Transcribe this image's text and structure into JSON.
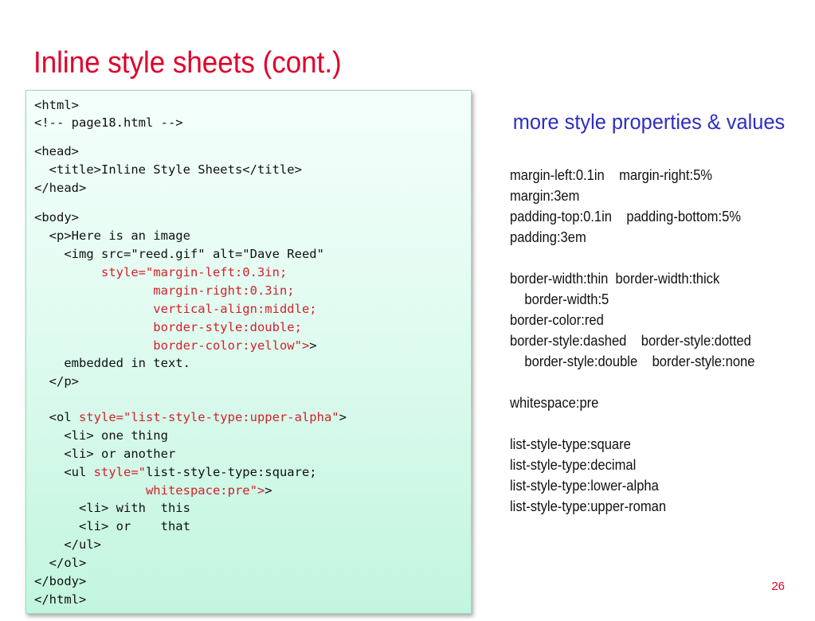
{
  "slide": {
    "title": "Inline style sheets (cont.)",
    "page_number": "26"
  },
  "code": {
    "lines": [
      "<html>",
      "<!-- page18.html -->",
      "<head>",
      "  <title>Inline Style Sheets</title>",
      "</head>",
      "<body>",
      "  <p>Here is an image",
      "    <img src=\"reed.gif\" alt=\"Dave Reed\"",
      "         style=\"margin-left:0.3in;",
      "                margin-right:0.3in;",
      "                vertical-align:middle;",
      "                border-style:double;",
      "                border-color:yellow\">",
      "    embedded in text.",
      "  </p>",
      "  <ol style=\"list-style-type:upper-alpha\">",
      "    <li> one thing",
      "    <li> or another",
      "    <ul style=\"list-style-type:square;",
      "               whitespace:pre\">",
      "      <li> with  this",
      "      <li> or    that",
      "    </ul>",
      "  </ol>",
      "</body>",
      "</html>"
    ],
    "line14_close": ">",
    "line19_open": "    <ul ",
    "line20_close": ">"
  },
  "properties": {
    "heading": "more style properties & values",
    "lines": [
      "margin-left:0.1in    margin-right:5%",
      "margin:3em",
      "padding-top:0.1in    padding-bottom:5%",
      "padding:3em",
      "border-width:thin  border-width:thick",
      "    border-width:5",
      "border-color:red",
      "border-style:dashed    border-style:dotted",
      "    border-style:double    border-style:none",
      "whitespace:pre",
      "list-style-type:square",
      "list-style-type:decimal",
      "list-style-type:lower-alpha",
      "list-style-type:upper-roman"
    ]
  },
  "colors": {
    "title": "#e0002a",
    "heading": "#2e2ec4",
    "code_attribute": "#d4212a",
    "code_box_bg": "#c2f5df"
  }
}
